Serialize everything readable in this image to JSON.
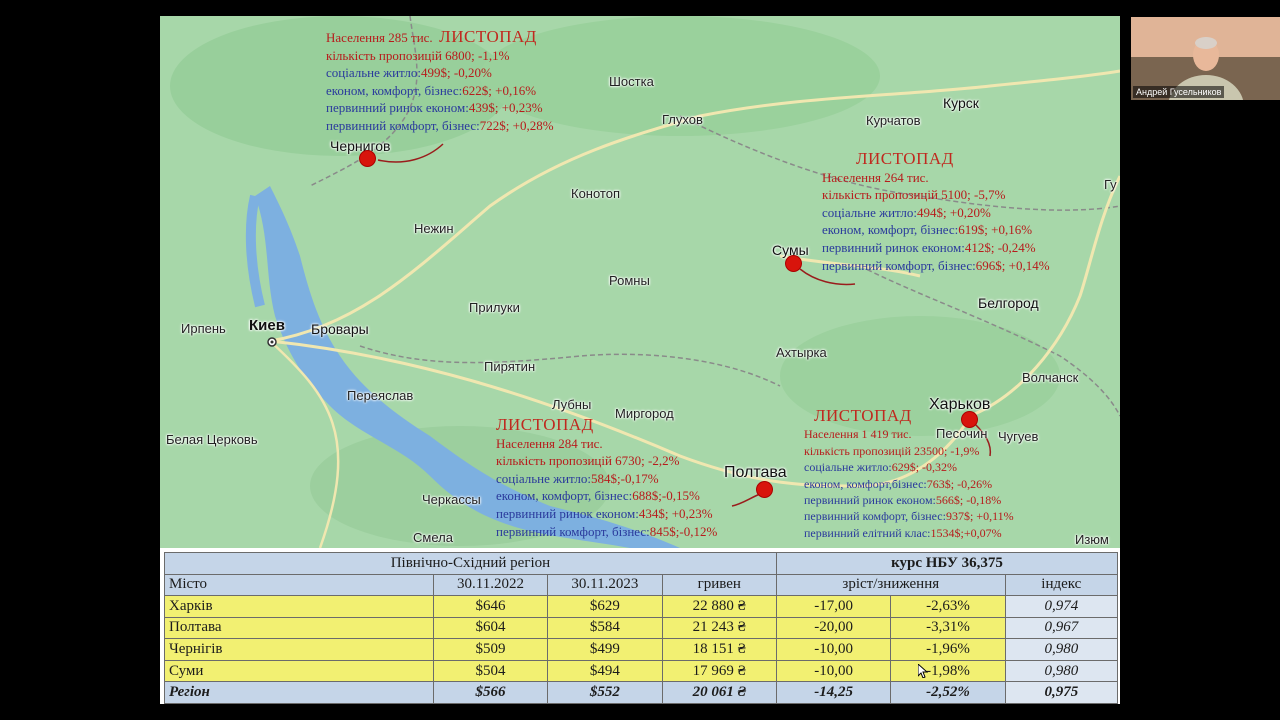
{
  "slide": {
    "cities": [
      {
        "id": "chernigov",
        "label": "Чернигов"
      },
      {
        "id": "shostka",
        "label": "Шостка"
      },
      {
        "id": "glukhov",
        "label": "Глухов"
      },
      {
        "id": "kursk",
        "label": "Курск"
      },
      {
        "id": "kurchatov",
        "label": "Курчатов"
      },
      {
        "id": "konotop",
        "label": "Конотоп"
      },
      {
        "id": "nezhin",
        "label": "Нежин"
      },
      {
        "id": "sumy",
        "label": "Сумы"
      },
      {
        "id": "romny",
        "label": "Ромны"
      },
      {
        "id": "belgorod",
        "label": "Белгород"
      },
      {
        "id": "priluki",
        "label": "Прилуки"
      },
      {
        "id": "irpen",
        "label": "Ирпень"
      },
      {
        "id": "kiev",
        "label": "Киев"
      },
      {
        "id": "brovary",
        "label": "Бровары"
      },
      {
        "id": "akhtyrka",
        "label": "Ахтырка"
      },
      {
        "id": "piryatin",
        "label": "Пирятин"
      },
      {
        "id": "volchansk",
        "label": "Волчанск"
      },
      {
        "id": "pereyaslav",
        "label": "Переяслав"
      },
      {
        "id": "lubny",
        "label": "Лубны"
      },
      {
        "id": "mirgorod",
        "label": "Миргород"
      },
      {
        "id": "kharkov",
        "label": "Харьков"
      },
      {
        "id": "belaya",
        "label": "Белая Церковь"
      },
      {
        "id": "pesochin",
        "label": "Песочин"
      },
      {
        "id": "chuguev",
        "label": "Чугуев"
      },
      {
        "id": "poltava",
        "label": "Полтава"
      },
      {
        "id": "cherkassy",
        "label": "Черкассы"
      },
      {
        "id": "smela",
        "label": "Смела"
      },
      {
        "id": "izyum",
        "label": "Изюм"
      },
      {
        "id": "gu",
        "label": "Гу"
      }
    ],
    "blocks": {
      "chernigov": {
        "month": "ЛИСТОПАД",
        "population": "Населення 285 тис.",
        "offers": "кількість пропозицій 6800; -1,1%",
        "social_n": "соціальне житло:",
        "social_v": "499$; -0,20%",
        "econ_n": "економ, комфорт, бізнес:",
        "econ_v": "622$; +0,16%",
        "prim_econ_n": "первинний ринок економ:",
        "prim_econ_v": "439$; +0,23%",
        "prim_comf_n": "первинний комфорт, бізнес:",
        "prim_comf_v": "722$; +0,28%"
      },
      "sumy": {
        "month": "ЛИСТОПАД",
        "population": "Населення 264 тис.",
        "offers": "кількість пропозицій 5100; -5,7%",
        "social_n": "соціальне житло:",
        "social_v": "494$; +0,20%",
        "econ_n": "економ, комфорт, бізнес:",
        "econ_v": "619$; +0,16%",
        "prim_econ_n": "первинний ринок економ:",
        "prim_econ_v": "412$; -0,24%",
        "prim_comf_n": "первинний комфорт, бізнес:",
        "prim_comf_v": "696$; +0,14%"
      },
      "poltava": {
        "month": "ЛИСТОПАД",
        "population": "Населення 284 тис.",
        "offers": "кількість пропозицій 6730; -2,2%",
        "social_n": "соціальне житло:",
        "social_v": "584$;-0,17%",
        "econ_n": "економ, комфорт, бізнес:",
        "econ_v": "688$;-0,15%",
        "prim_econ_n": "первинний ринок економ:",
        "prim_econ_v": "434$; +0,23%",
        "prim_comf_n": "первинний комфорт, бізнес:",
        "prim_comf_v": "845$;-0,12%"
      },
      "kharkov": {
        "month": "ЛИСТОПАД",
        "population": "Населення 1 419 тис.",
        "offers": "кількість пропозицій 23500; -1,9%",
        "social_n": "соціальне житло:",
        "social_v": "629$; -0,32%",
        "econ_n": "економ, комфорт,бізнес:",
        "econ_v": "763$; -0,26%",
        "prim_econ_n": "первинний ринок економ:",
        "prim_econ_v": "566$; -0,18%",
        "prim_comf_n": "первинний комфорт, бізнес:",
        "prim_comf_v": "937$; +0,11%",
        "elite_n": "первинний елітний клас:",
        "elite_v": "1534$;+0,07%"
      }
    },
    "table": {
      "region_title": "Північно-Східний регіон",
      "rate_title": "курс НБУ 36,375",
      "headers": [
        "Місто",
        "30.11.2022",
        "30.11.2023",
        "гривен",
        "зріст/зниження",
        "індекс"
      ],
      "rows": [
        {
          "city": "Харків",
          "y2022": "$646",
          "y2023": "$629",
          "uah": "22 880 ₴",
          "abs": "-17,00",
          "pct": "-2,63%",
          "idx": "0,974"
        },
        {
          "city": "Полтава",
          "y2022": "$604",
          "y2023": "$584",
          "uah": "21 243 ₴",
          "abs": "-20,00",
          "pct": "-3,31%",
          "idx": "0,967"
        },
        {
          "city": "Чернігів",
          "y2022": "$509",
          "y2023": "$499",
          "uah": "18 151 ₴",
          "abs": "-10,00",
          "pct": "-1,96%",
          "idx": "0,980"
        },
        {
          "city": "Суми",
          "y2022": "$504",
          "y2023": "$494",
          "uah": "17 969 ₴",
          "abs": "-10,00",
          "pct": "-1,98%",
          "idx": "0,980"
        }
      ],
      "total": {
        "city": "Регіон",
        "y2022": "$566",
        "y2023": "$552",
        "uah": "20 061 ₴",
        "abs": "-14,25",
        "pct": "-2,52%",
        "idx": "0,975"
      }
    }
  },
  "webcam": {
    "name": "Андрей Гусельников"
  },
  "colors": {
    "map": "#a7d7a9",
    "marker": "#d8140c",
    "table_yellow": "#f2f072",
    "table_blue": "#c5d5e8"
  }
}
